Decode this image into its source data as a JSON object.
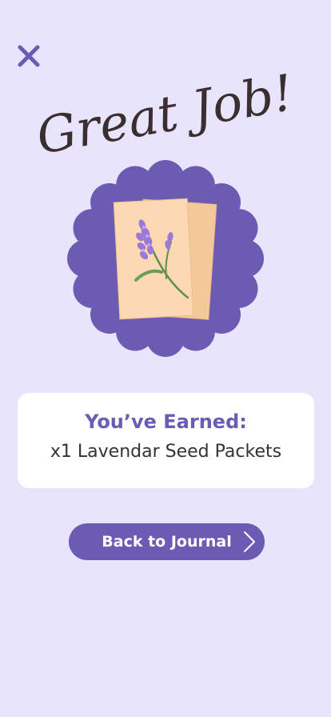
{
  "header": {
    "title": "Great Job!",
    "close_icon": "close-icon"
  },
  "reward": {
    "heading": "You’ve Earned:",
    "item": "x1 Lavendar Seed Packets",
    "badge_icon": "lavender-seed-packet-icon"
  },
  "actions": {
    "back_label": "Back to Journal",
    "back_icon": "chevron-right-icon"
  },
  "colors": {
    "background": "#e7e4fc",
    "accent": "#6b5bb3",
    "heading": "#6a5bb5",
    "title_script": "#3a2e30",
    "card": "#ffffff",
    "packet": "#fbd3a8"
  }
}
